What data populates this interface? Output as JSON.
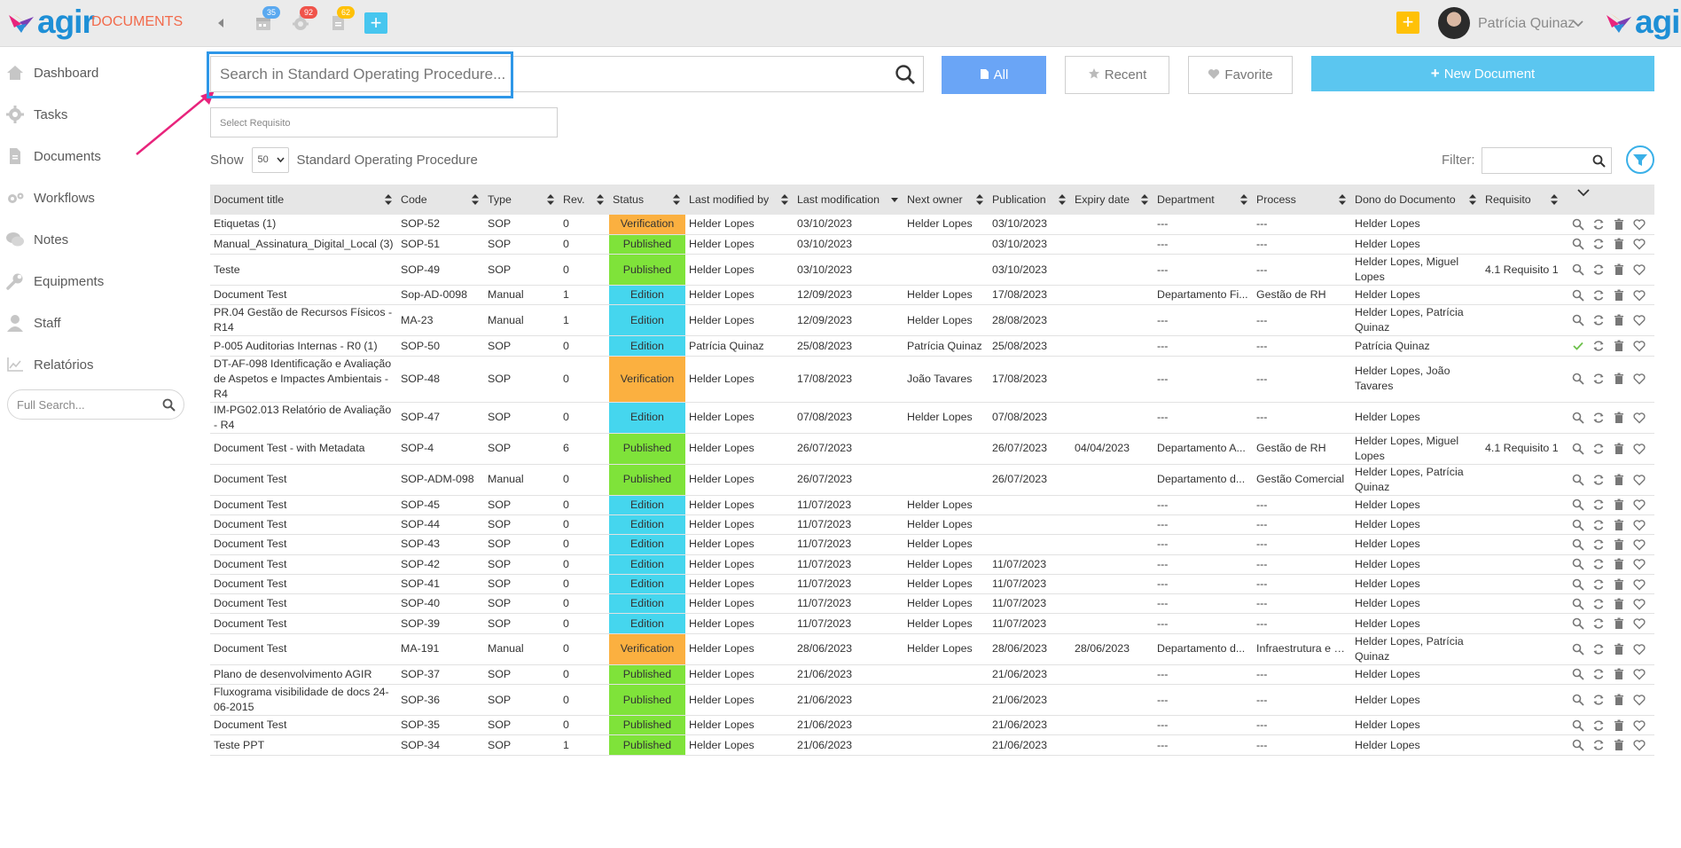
{
  "app": {
    "name": "DOCUMENTS",
    "logo_text": "agir"
  },
  "topbar": {
    "badges": [
      {
        "icon": "calendar-icon",
        "count": "35",
        "color": "#5aa9f0"
      },
      {
        "icon": "gear-icon",
        "count": "92",
        "color": "#f0534a"
      },
      {
        "icon": "document-icon",
        "count": "62",
        "color": "#ffc107"
      }
    ],
    "add_symbol": "+",
    "quick_add_symbol": "+",
    "user_name": "Patrícia Quinaz"
  },
  "sidebar": {
    "items": [
      {
        "label": "Dashboard",
        "icon": "home-icon"
      },
      {
        "label": "Tasks",
        "icon": "gear-icon"
      },
      {
        "label": "Documents",
        "icon": "document-icon"
      },
      {
        "label": "Workflows",
        "icon": "gears-icon"
      },
      {
        "label": "Notes",
        "icon": "chat-icon"
      },
      {
        "label": "Equipments",
        "icon": "wrench-icon"
      },
      {
        "label": "Staff",
        "icon": "user-icon"
      },
      {
        "label": "Relatórios",
        "icon": "chart-icon"
      }
    ],
    "full_search_placeholder": "Full Search..."
  },
  "main": {
    "search_placeholder": "Search in Standard Operating Procedure...",
    "filters": {
      "all": "All",
      "recent": "Recent",
      "favorite": "Favorite"
    },
    "new_document": "New Document",
    "select_requisito": "Select Requisito",
    "show_label": "Show",
    "page_size": "50",
    "category": "Standard Operating Procedure",
    "filter_label": "Filter:"
  },
  "table": {
    "columns": [
      "Document title",
      "Code",
      "Type",
      "Rev.",
      "Status",
      "Last modified by",
      "Last modification",
      "Next owner",
      "Publication",
      "Expiry date",
      "Department",
      "Process",
      "Dono do Documento",
      "Requisito"
    ],
    "rows": [
      [
        "Etiquetas (1)",
        "SOP-52",
        "SOP",
        "0",
        "Verification",
        "Helder Lopes",
        "03/10/2023",
        "Helder Lopes",
        "03/10/2023",
        "",
        "---",
        "---",
        "Helder Lopes",
        ""
      ],
      [
        "Manual_Assinatura_Digital_Local (3)",
        "SOP-51",
        "SOP",
        "0",
        "Published",
        "Helder Lopes",
        "03/10/2023",
        "",
        "03/10/2023",
        "",
        "---",
        "---",
        "Helder Lopes",
        ""
      ],
      [
        "Teste",
        "SOP-49",
        "SOP",
        "0",
        "Published",
        "Helder Lopes",
        "03/10/2023",
        "",
        "03/10/2023",
        "",
        "---",
        "---",
        "Helder Lopes, Miguel Lopes",
        "4.1 Requisito 1"
      ],
      [
        "Document Test",
        "Sop-AD-0098",
        "Manual",
        "1",
        "Edition",
        "Helder Lopes",
        "12/09/2023",
        "Helder Lopes",
        "17/08/2023",
        "",
        "Departamento Fi...",
        "Gestão de RH",
        "Helder Lopes",
        ""
      ],
      [
        "PR.04 Gestão de Recursos Físicos - R14",
        "MA-23",
        "Manual",
        "1",
        "Edition",
        "Helder Lopes",
        "12/09/2023",
        "Helder Lopes",
        "28/08/2023",
        "",
        "---",
        "---",
        "Helder Lopes, Patrícia Quinaz",
        ""
      ],
      [
        "P-005 Auditorias Internas - R0 (1)",
        "SOP-50",
        "SOP",
        "0",
        "Edition",
        "Patrícia Quinaz",
        "25/08/2023",
        "Patrícia Quinaz",
        "25/08/2023",
        "",
        "---",
        "---",
        "Patrícia Quinaz",
        ""
      ],
      [
        "DT-AF-098 Identificação e Avaliação de Aspetos e Impactes Ambientais - R4",
        "SOP-48",
        "SOP",
        "0",
        "Verification",
        "Helder Lopes",
        "17/08/2023",
        "João Tavares",
        "17/08/2023",
        "",
        "---",
        "---",
        "Helder Lopes, João Tavares",
        ""
      ],
      [
        "IM-PG02.013 Relatório de Avaliação - R4",
        "SOP-47",
        "SOP",
        "0",
        "Edition",
        "Helder Lopes",
        "07/08/2023",
        "Helder Lopes",
        "07/08/2023",
        "",
        "---",
        "---",
        "Helder Lopes",
        ""
      ],
      [
        "Document Test - with Metadata",
        "SOP-4",
        "SOP",
        "6",
        "Published",
        "Helder Lopes",
        "26/07/2023",
        "",
        "26/07/2023",
        "04/04/2023",
        "Departamento A...",
        "Gestão de RH",
        "Helder Lopes, Miguel Lopes",
        "4.1 Requisito 1"
      ],
      [
        "Document Test",
        "SOP-ADM-098",
        "Manual",
        "0",
        "Published",
        "Helder Lopes",
        "26/07/2023",
        "",
        "26/07/2023",
        "",
        "Departamento d...",
        "Gestão Comercial",
        "Helder Lopes, Patrícia Quinaz",
        ""
      ],
      [
        "Document Test",
        "SOP-45",
        "SOP",
        "0",
        "Edition",
        "Helder Lopes",
        "11/07/2023",
        "Helder Lopes",
        "",
        "",
        "---",
        "---",
        "Helder Lopes",
        ""
      ],
      [
        "Document Test",
        "SOP-44",
        "SOP",
        "0",
        "Edition",
        "Helder Lopes",
        "11/07/2023",
        "Helder Lopes",
        "",
        "",
        "---",
        "---",
        "Helder Lopes",
        ""
      ],
      [
        "Document Test",
        "SOP-43",
        "SOP",
        "0",
        "Edition",
        "Helder Lopes",
        "11/07/2023",
        "Helder Lopes",
        "",
        "",
        "---",
        "---",
        "Helder Lopes",
        ""
      ],
      [
        "Document Test",
        "SOP-42",
        "SOP",
        "0",
        "Edition",
        "Helder Lopes",
        "11/07/2023",
        "Helder Lopes",
        "11/07/2023",
        "",
        "---",
        "---",
        "Helder Lopes",
        ""
      ],
      [
        "Document Test",
        "SOP-41",
        "SOP",
        "0",
        "Edition",
        "Helder Lopes",
        "11/07/2023",
        "Helder Lopes",
        "11/07/2023",
        "",
        "---",
        "---",
        "Helder Lopes",
        ""
      ],
      [
        "Document Test",
        "SOP-40",
        "SOP",
        "0",
        "Edition",
        "Helder Lopes",
        "11/07/2023",
        "Helder Lopes",
        "11/07/2023",
        "",
        "---",
        "---",
        "Helder Lopes",
        ""
      ],
      [
        "Document Test",
        "SOP-39",
        "SOP",
        "0",
        "Edition",
        "Helder Lopes",
        "11/07/2023",
        "Helder Lopes",
        "11/07/2023",
        "",
        "---",
        "---",
        "Helder Lopes",
        ""
      ],
      [
        "Document Test",
        "MA-191",
        "Manual",
        "0",
        "Verification",
        "Helder Lopes",
        "28/06/2023",
        "Helder Lopes",
        "28/06/2023",
        "28/06/2023",
        "Departamento d...",
        "Infraestrutura e S...",
        "Helder Lopes, Patrícia Quinaz",
        ""
      ],
      [
        "Plano de desenvolvimento AGIR",
        "SOP-37",
        "SOP",
        "0",
        "Published",
        "Helder Lopes",
        "21/06/2023",
        "",
        "21/06/2023",
        "",
        "---",
        "---",
        "Helder Lopes",
        ""
      ],
      [
        "Fluxograma visibilidade de docs 24-06-2015",
        "SOP-36",
        "SOP",
        "0",
        "Published",
        "Helder Lopes",
        "21/06/2023",
        "",
        "21/06/2023",
        "",
        "---",
        "---",
        "Helder Lopes",
        ""
      ],
      [
        "Document Test",
        "SOP-35",
        "SOP",
        "0",
        "Published",
        "Helder Lopes",
        "21/06/2023",
        "",
        "21/06/2023",
        "",
        "---",
        "---",
        "Helder Lopes",
        ""
      ],
      [
        "Teste PPT",
        "SOP-34",
        "SOP",
        "1",
        "Published",
        "Helder Lopes",
        "21/06/2023",
        "",
        "21/06/2023",
        "",
        "---",
        "---",
        "Helder Lopes",
        ""
      ]
    ],
    "approved_row_index": 5,
    "status_colors": {
      "Verification": "#fbb040",
      "Published": "#7fe33a",
      "Edition": "#45d6ee"
    }
  }
}
